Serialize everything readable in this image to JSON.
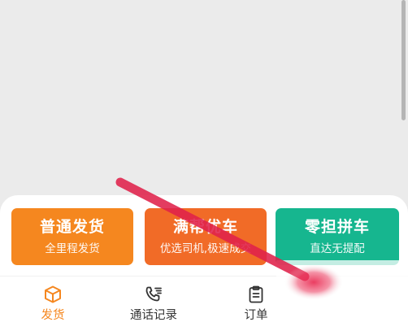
{
  "services": [
    {
      "title": "普通发货",
      "subtitle": "全里程发货",
      "color": "#f5871f"
    },
    {
      "title": "满帮优车",
      "subtitle": "优选司机,极速成交",
      "color": "#f16b27"
    },
    {
      "title": "零担拼车",
      "subtitle": "直达无提配",
      "color": "#16b68f"
    }
  ],
  "tabs": [
    {
      "label": "发货",
      "icon": "box-icon",
      "active": true
    },
    {
      "label": "通话记录",
      "icon": "call-log-icon",
      "active": false
    },
    {
      "label": "订单",
      "icon": "clipboard-icon",
      "active": false
    }
  ],
  "colors": {
    "accent": "#f5871f",
    "annotation_arrow": "#e8274f"
  }
}
